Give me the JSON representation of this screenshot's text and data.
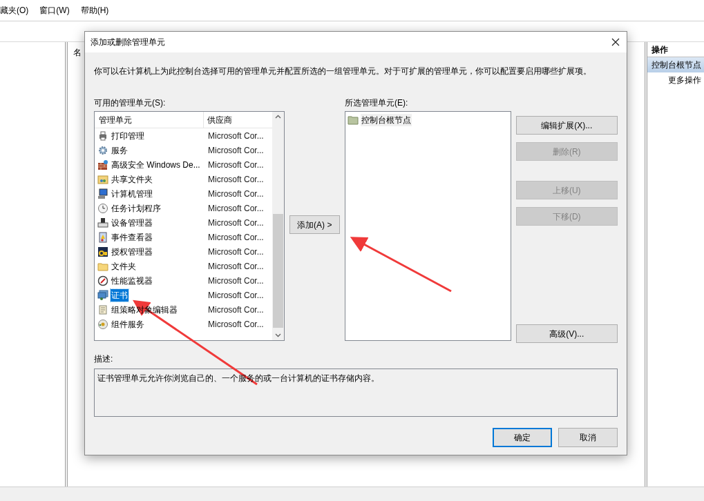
{
  "menu": [
    "藏夹(O)",
    "窗口(W)",
    "帮助(H)"
  ],
  "center_pane": {
    "column_1": "名"
  },
  "actions_pane": {
    "title": "操作",
    "items": [
      {
        "label": "控制台根节点",
        "selected": true
      },
      {
        "label": "更多操作",
        "selected": false
      }
    ]
  },
  "dialog": {
    "title": "添加或删除管理单元",
    "intro": "你可以在计算机上为此控制台选择可用的管理单元并配置所选的一组管理单元。对于可扩展的管理单元，你可以配置要启用哪些扩展项。",
    "available_label": "可用的管理单元(S):",
    "available": {
      "columns": [
        "管理单元",
        "供应商"
      ],
      "rows": [
        {
          "name": "打印管理",
          "vendor": "Microsoft Cor...",
          "selected": false
        },
        {
          "name": "服务",
          "vendor": "Microsoft Cor...",
          "selected": false
        },
        {
          "name": "高级安全 Windows De...",
          "vendor": "Microsoft Cor...",
          "selected": false
        },
        {
          "name": "共享文件夹",
          "vendor": "Microsoft Cor...",
          "selected": false
        },
        {
          "name": "计算机管理",
          "vendor": "Microsoft Cor...",
          "selected": false
        },
        {
          "name": "任务计划程序",
          "vendor": "Microsoft Cor...",
          "selected": false
        },
        {
          "name": "设备管理器",
          "vendor": "Microsoft Cor...",
          "selected": false
        },
        {
          "name": "事件查看器",
          "vendor": "Microsoft Cor...",
          "selected": false
        },
        {
          "name": "授权管理器",
          "vendor": "Microsoft Cor...",
          "selected": false
        },
        {
          "name": "文件夹",
          "vendor": "Microsoft Cor...",
          "selected": false
        },
        {
          "name": "性能监视器",
          "vendor": "Microsoft Cor...",
          "selected": false
        },
        {
          "name": "证书",
          "vendor": "Microsoft Cor...",
          "selected": true
        },
        {
          "name": "组策略对象编辑器",
          "vendor": "Microsoft Cor...",
          "selected": false
        },
        {
          "name": "组件服务",
          "vendor": "Microsoft Cor...",
          "selected": false
        }
      ]
    },
    "add_button": "添加(A) >",
    "selected_label": "所选管理单元(E):",
    "selected_items": [
      "控制台根节点"
    ],
    "side_buttons": [
      {
        "label": "编辑扩展(X)...",
        "disabled": false
      },
      {
        "label": "删除(R)",
        "disabled": true
      },
      {
        "label": "上移(U)",
        "disabled": true
      },
      {
        "label": "下移(D)",
        "disabled": true
      },
      {
        "label": "高级(V)...",
        "disabled": false
      }
    ],
    "description_label": "描述:",
    "description": "证书管理单元允许你浏览自己的、一个服务的或一台计算机的证书存储内容。",
    "buttons": [
      {
        "label": "确定",
        "default": true
      },
      {
        "label": "取消",
        "default": false
      }
    ]
  }
}
